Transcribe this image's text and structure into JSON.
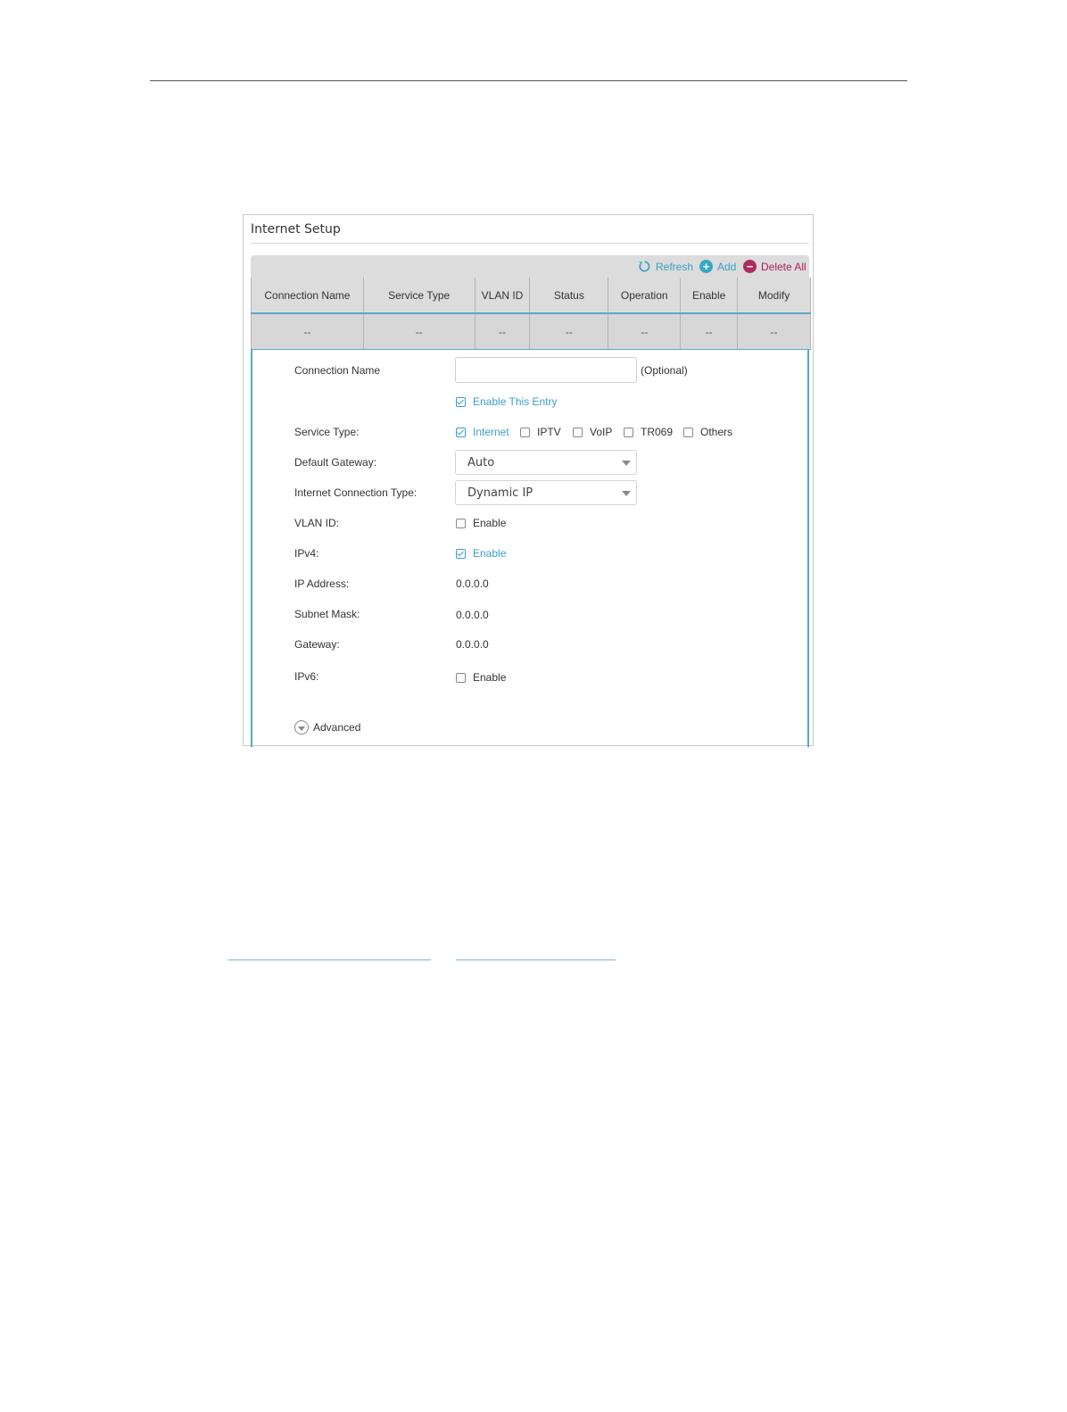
{
  "panel": {
    "title": "Internet Setup"
  },
  "toolbar": {
    "refresh_label": "Refresh",
    "add_label": "Add",
    "delete_all_label": "Delete All",
    "accent_color": "#3aa0c8",
    "delete_color": "#b02a5f"
  },
  "table": {
    "headers": [
      "Connection Name",
      "Service Type",
      "VLAN ID",
      "Status",
      "Operation",
      "Enable",
      "Modify"
    ],
    "row": [
      "--",
      "--",
      "--",
      "--",
      "--",
      "--",
      "--"
    ]
  },
  "form": {
    "connection_name_label": "Connection Name",
    "connection_name_value": "",
    "optional_text": "(Optional)",
    "enable_entry_label": "Enable This Entry",
    "enable_entry_checked": true,
    "service_type_label": "Service Type:",
    "service_types": [
      {
        "label": "Internet",
        "checked": true
      },
      {
        "label": "IPTV",
        "checked": false
      },
      {
        "label": "VoIP",
        "checked": false
      },
      {
        "label": "TR069",
        "checked": false
      },
      {
        "label": "Others",
        "checked": false
      }
    ],
    "default_gateway_label": "Default Gateway:",
    "default_gateway_value": "Auto",
    "connection_type_label": "Internet Connection Type:",
    "connection_type_value": "Dynamic IP",
    "vlan_id_label": "VLAN ID:",
    "vlan_enable_label": "Enable",
    "vlan_enable_checked": false,
    "ipv4_label": "IPv4:",
    "ipv4_enable_label": "Enable",
    "ipv4_enable_checked": true,
    "ip_address_label": "IP Address:",
    "ip_address_value": "0.0.0.0",
    "subnet_mask_label": "Subnet Mask:",
    "subnet_mask_value": "0.0.0.0",
    "gateway_label": "Gateway:",
    "gateway_value": "0.0.0.0",
    "ipv6_label": "IPv6:",
    "ipv6_enable_label": "Enable",
    "ipv6_enable_checked": false,
    "advanced_label": "Advanced"
  }
}
